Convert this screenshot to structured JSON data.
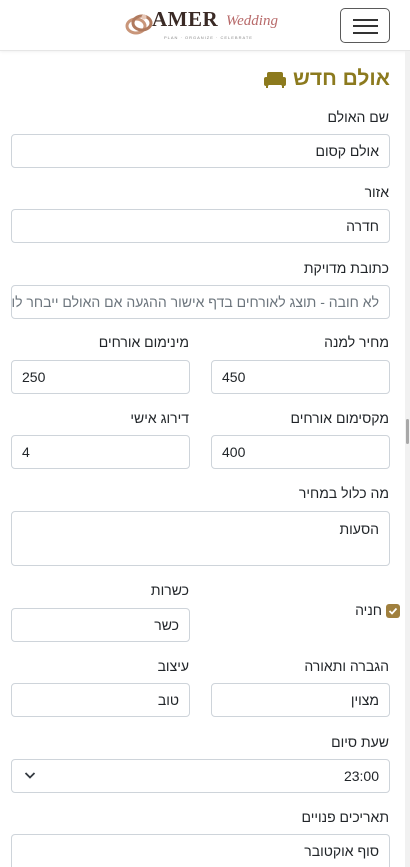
{
  "brand": {
    "logo_main": "AMER",
    "logo_script": "Wedding",
    "logo_tagline": "PLAN · ORGANIZE · CELEBRATE"
  },
  "page": {
    "title": "אולם חדש",
    "title_icon": "sofa-icon"
  },
  "form": {
    "hall_name": {
      "label": "שם האולם",
      "value": "אולם קסום"
    },
    "region": {
      "label": "אזור",
      "value": "חדרה"
    },
    "address": {
      "label": "כתובת מדויקת",
      "placeholder": "לא חובה - תוצג לאורחים בדף אישור ההגעה אם האולם ייבחר לו"
    },
    "price_per_plate": {
      "label": "מחיר למנה",
      "value": "450"
    },
    "min_guests": {
      "label": "מינימום אורחים",
      "value": "250"
    },
    "max_guests": {
      "label": "מקסימום אורחים",
      "value": "400"
    },
    "personal_rating": {
      "label": "דירוג אישי",
      "value": "4"
    },
    "included": {
      "label": "מה כלול במחיר",
      "value": "הסעות"
    },
    "parking": {
      "label": "חניה",
      "checked": true
    },
    "kosher": {
      "label": "כשרות",
      "value": "כשר"
    },
    "sound_light": {
      "label": "הגברה ותאורה",
      "value": "מצוין"
    },
    "design": {
      "label": "עיצוב",
      "value": "טוב"
    },
    "end_time": {
      "label": "שעת סיום",
      "value": "23:00"
    },
    "free_dates": {
      "label": "תאריכים פנויים",
      "value": "סוף אוקטובר"
    }
  },
  "colors": {
    "accent": "#8c7a1e",
    "checkbox": "#a0803e",
    "border": "#ced4da"
  }
}
